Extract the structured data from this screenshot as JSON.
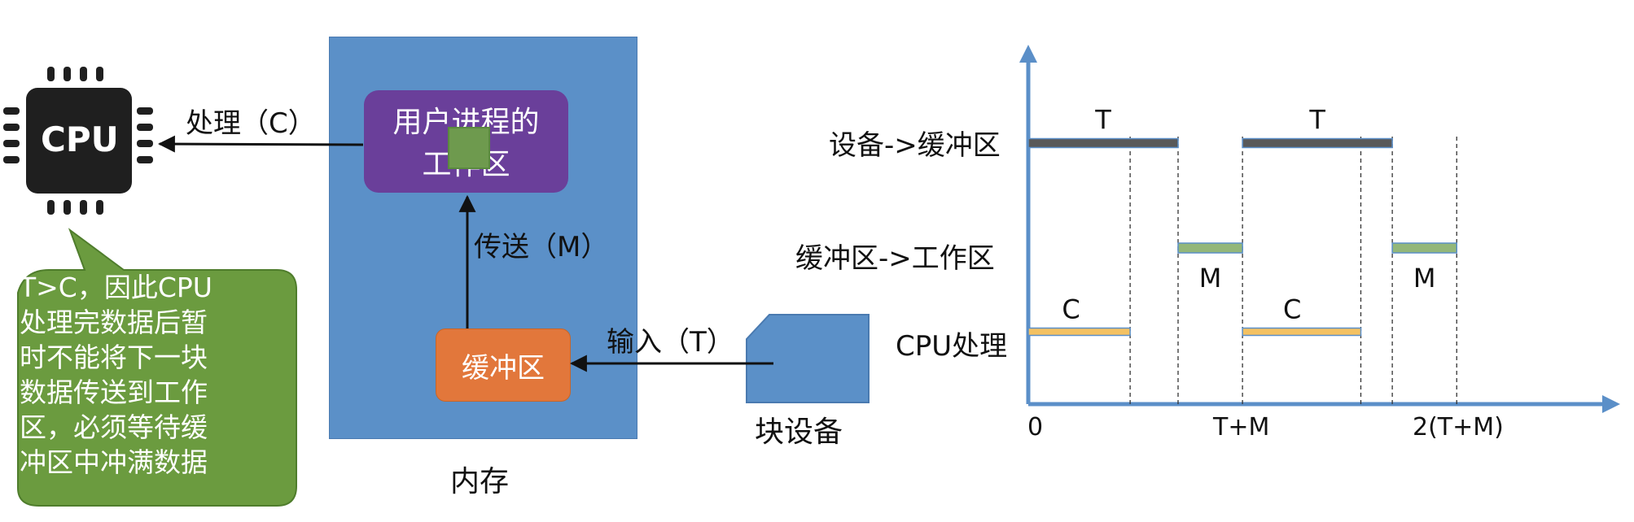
{
  "left_diagram": {
    "cpu_label": "CPU",
    "process_label": "处理（C）",
    "process_box_line1": "用户进程的",
    "process_box_line2": "工作区",
    "transfer_label": "传送（M）",
    "buffer_label": "缓冲区",
    "input_label": "输入（T）",
    "device_label": "块设备",
    "memory_label": "内存",
    "note_lines": [
      "T>C，因此CPU",
      "处理完数据后暂",
      "时不能将下一块",
      "数据传送到工作",
      "区，必须等待缓",
      "冲区中冲满数据"
    ]
  },
  "chart_data": {
    "type": "gantt",
    "rows": [
      "设备->缓冲区",
      "缓冲区->工作区",
      "CPU处理"
    ],
    "x_ticks": [
      "0",
      "T+M",
      "2(T+M)"
    ],
    "segments": [
      {
        "row": "设备->缓冲区",
        "label": "T",
        "start": 0,
        "end": 1
      },
      {
        "row": "设备->缓冲区",
        "label": "T",
        "start": 1.43,
        "end": 2.43
      },
      {
        "row": "缓冲区->工作区",
        "label": "M",
        "start": 1,
        "end": 1.43
      },
      {
        "row": "缓冲区->工作区",
        "label": "M",
        "start": 2.43,
        "end": 2.86
      },
      {
        "row": "CPU处理",
        "label": "C",
        "start": 0,
        "end": 0.68
      },
      {
        "row": "CPU处理",
        "label": "C",
        "start": 1.43,
        "end": 2.22
      }
    ],
    "colors": {
      "T": "#595959",
      "M": "#93b77a",
      "C": "#f4c162",
      "axis": "#5b8fc8"
    }
  }
}
